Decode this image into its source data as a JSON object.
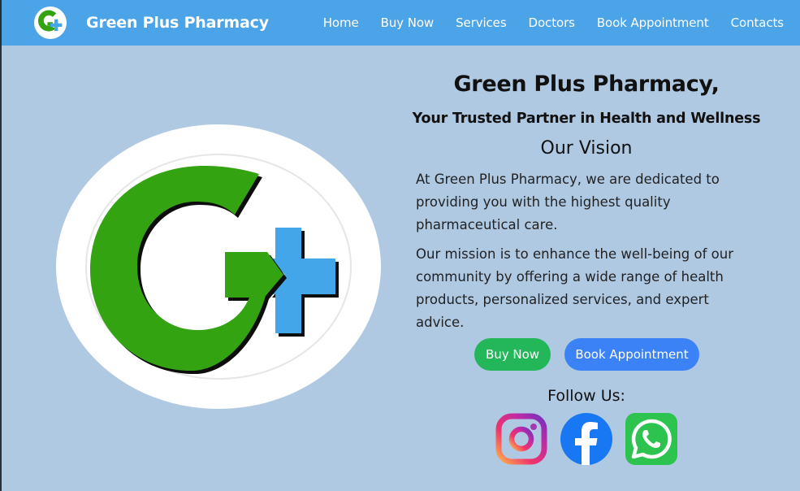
{
  "nav": {
    "brand": "Green Plus Pharmacy",
    "links": [
      "Home",
      "Buy Now",
      "Services",
      "Doctors",
      "Book Appointment",
      "Contacts"
    ]
  },
  "hero": {
    "title": "Green Plus Pharmacy,",
    "subtitle": "Your Trusted Partner in Health and Wellness",
    "vision_heading": "Our Vision",
    "paragraph1": "At Green Plus Pharmacy, we are dedicated to providing you with the highest quality pharmaceutical care.",
    "paragraph2": "Our mission is to enhance the well-being of our community by offering a wide range of health products, personalized services, and expert advice.",
    "buy_button": "Buy Now",
    "book_button": "Book Appointment",
    "follow_label": "Follow Us:"
  },
  "social": [
    "instagram-icon",
    "facebook-icon",
    "whatsapp-icon"
  ],
  "colors": {
    "navbar": "#4ba3e8",
    "background": "#b0c9e3",
    "brand_green": "#34a312",
    "brand_blue": "#42a6e8",
    "buy_button": "#23b75a",
    "book_button": "#3b82f6"
  }
}
